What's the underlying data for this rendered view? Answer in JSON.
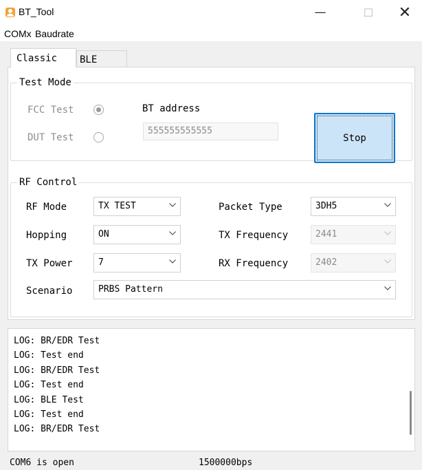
{
  "window": {
    "title": "BT_Tool",
    "minimize_glyph": "—",
    "maximize_glyph": "☐",
    "close_glyph": "✕",
    "icon": "app-icon"
  },
  "menu": {
    "items": [
      "COMx",
      "Baudrate"
    ]
  },
  "tabs": {
    "items": [
      {
        "label": "Classic",
        "selected": true
      },
      {
        "label": "BLE",
        "selected": false
      }
    ]
  },
  "test_mode": {
    "title": "Test Mode",
    "fcc_label": "FCC Test",
    "fcc_checked": true,
    "dut_label": "DUT Test",
    "dut_checked": false,
    "bt_address_label": "BT address",
    "bt_address_value": "555555555555",
    "stop_button_label": "Stop"
  },
  "rf_control": {
    "title": "RF Control",
    "rf_mode_label": "RF Mode",
    "rf_mode_value": "TX TEST",
    "hopping_label": "Hopping",
    "hopping_value": "ON",
    "tx_power_label": "TX Power",
    "tx_power_value": "7",
    "scenario_label": "Scenario",
    "scenario_value": "PRBS Pattern",
    "packet_type_label": "Packet Type",
    "packet_type_value": "3DH5",
    "tx_frequency_label": "TX Frequency",
    "tx_frequency_value": "2441",
    "rx_frequency_label": "RX Frequency",
    "rx_frequency_value": "2402"
  },
  "log": {
    "lines": [
      "LOG: BR/EDR Test",
      "LOG: Test end",
      "LOG: BR/EDR Test",
      "LOG: Test end",
      "LOG: BLE Test",
      "LOG: Test end",
      "LOG: BR/EDR Test"
    ]
  },
  "status": {
    "port": "COM6 is open",
    "baudrate": "1500000bps"
  },
  "colors": {
    "accent": "#0078d4",
    "button_fill": "#cce4f7",
    "window_bg": "#f0f0f0"
  }
}
